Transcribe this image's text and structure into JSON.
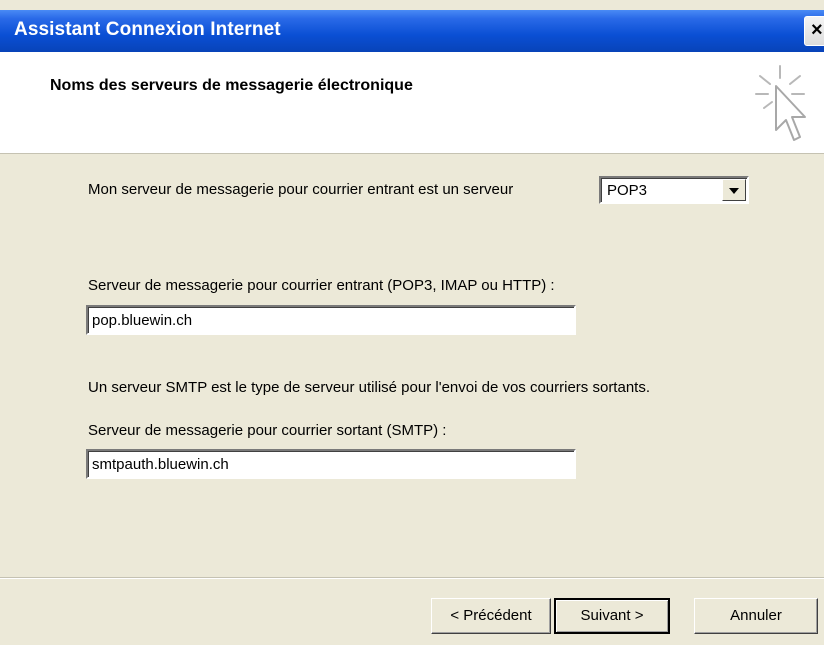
{
  "window": {
    "title": "Assistant Connexion Internet",
    "close_symbol": "×"
  },
  "header": {
    "heading": "Noms des serveurs de messagerie électronique",
    "icon": "wizard-cursor-icon"
  },
  "form": {
    "incoming_type_label": "Mon serveur de messagerie pour courrier entrant est un serveur",
    "incoming_type_value": "POP3",
    "incoming_server_label": "Serveur de messagerie pour courrier entrant (POP3, IMAP ou HTTP) :",
    "incoming_server_value": "pop.bluewin.ch",
    "smtp_info": "Un serveur SMTP est le type de serveur utilisé pour l'envoi de vos courriers sortants.",
    "outgoing_server_label": "Serveur de messagerie pour courrier sortant (SMTP) :",
    "outgoing_server_value": "smtpauth.bluewin.ch"
  },
  "buttons": {
    "back": "< Précédent",
    "next": "Suivant >",
    "cancel": "Annuler"
  },
  "colors": {
    "titlebar": "#0a4fd4",
    "dialog_bg": "#ece9d8",
    "header_bg": "#ffffff"
  }
}
